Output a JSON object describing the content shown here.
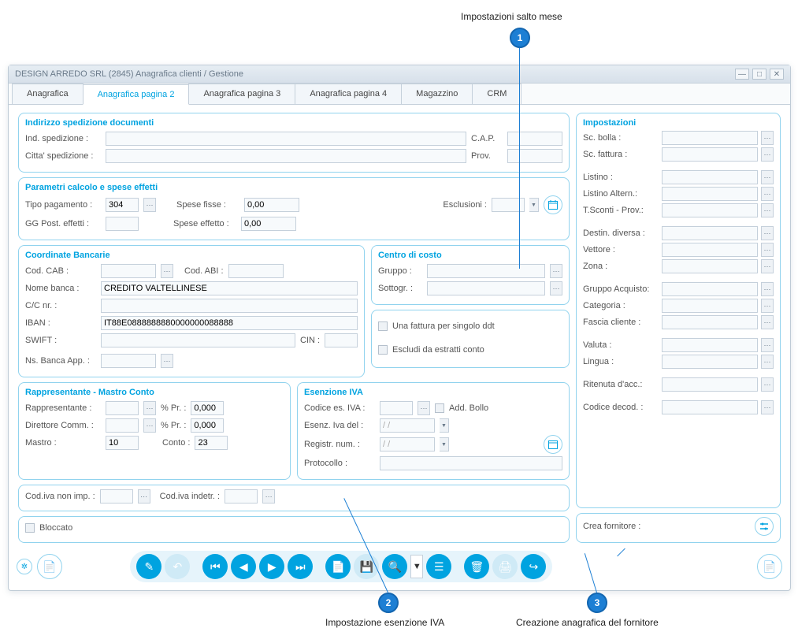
{
  "callouts": {
    "c1": {
      "num": "1",
      "label": "Impostazioni salto mese"
    },
    "c2": {
      "num": "2",
      "label": "Impostazione esenzione IVA"
    },
    "c3": {
      "num": "3",
      "label": "Creazione anagrafica del fornitore"
    }
  },
  "window": {
    "title": "DESIGN ARREDO SRL (2845) Anagrafica clienti / Gestione"
  },
  "tabs": [
    "Anagrafica",
    "Anagrafica pagina 2",
    "Anagrafica pagina 3",
    "Anagrafica pagina 4",
    "Magazzino",
    "CRM"
  ],
  "g_indirizzo": {
    "title": "Indirizzo spedizione documenti",
    "ind_spedizione_lbl": "Ind. spedizione :",
    "citta_lbl": "Citta' spedizione :",
    "cap_lbl": "C.A.P.",
    "prov_lbl": "Prov."
  },
  "g_param": {
    "title": "Parametri calcolo e spese effetti",
    "tipo_pag_lbl": "Tipo pagamento :",
    "tipo_pag_val": "304",
    "gg_lbl": "GG Post. effetti :",
    "fisse_lbl": "Spese fisse :",
    "fisse_val": "0,00",
    "effetto_lbl": "Spese effetto :",
    "effetto_val": "0,00",
    "esclusioni_lbl": "Esclusioni :"
  },
  "g_bancarie": {
    "title": "Coordinate Bancarie",
    "cab_lbl": "Cod. CAB :",
    "abi_lbl": "Cod. ABI :",
    "nome_lbl": "Nome banca :",
    "nome_val": "CREDITO VALTELLINESE",
    "cc_lbl": "C/C nr. :",
    "iban_lbl": "IBAN :",
    "iban_val": "IT88E0888888880000000088888",
    "swift_lbl": "SWIFT :",
    "cin_lbl": "CIN :",
    "banca_app_lbl": "Ns. Banca App. :"
  },
  "g_centro": {
    "title": "Centro di costo",
    "gruppo_lbl": "Gruppo :",
    "sottogr_lbl": "Sottogr. :"
  },
  "g_checks": {
    "singolo_lbl": "Una fattura per singolo ddt",
    "escludi_lbl": "Escludi da estratti conto"
  },
  "g_rappr": {
    "title": "Rappresentante - Mastro Conto",
    "rappr_lbl": "Rappresentante :",
    "dir_lbl": "Direttore Comm. :",
    "perc_lbl": "% Pr. :",
    "perc_val": "0,000",
    "mastro_lbl": "Mastro :",
    "mastro_val": "10",
    "conto_lbl": "Conto :",
    "conto_val": "23"
  },
  "g_esenz": {
    "title": "Esenzione IVA",
    "cod_lbl": "Codice es. IVA :",
    "bollo_lbl": "Add. Bollo",
    "del_lbl": "Esenz. Iva del :",
    "del_val": "/ /",
    "reg_lbl": "Registr. num. :",
    "reg_val": "/ /",
    "protocollo_lbl": "Protocollo :"
  },
  "g_codiva": {
    "nonimp_lbl": "Cod.iva non imp. :",
    "indetr_lbl": "Cod.iva indetr. :"
  },
  "g_bloccato": {
    "lbl": "Bloccato"
  },
  "g_impost": {
    "title": "Impostazioni",
    "fields": [
      "Sc. bolla :",
      "Sc. fattura :",
      "Listino :",
      "Listino Altern.:",
      "T.Sconti - Prov.:",
      "Destin. diversa :",
      "Vettore :",
      "Zona :",
      "Gruppo Acquisto:",
      "Categoria :",
      "Fascia cliente :",
      "Valuta :",
      "Lingua :",
      "Ritenuta d'acc.:",
      "Codice decod. :"
    ]
  },
  "g_fornitore": {
    "lbl": "Crea fornitore :"
  }
}
